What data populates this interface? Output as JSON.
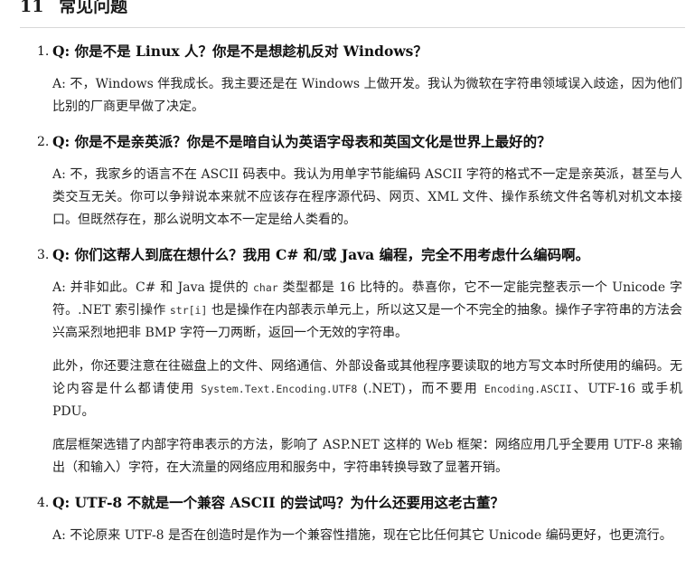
{
  "section": {
    "number": "11",
    "title": "常见问题"
  },
  "faq": [
    {
      "num": "1.",
      "question": "Q: 你是不是 Linux 人？你是不是想趁机反对 Windows？",
      "answers": [
        [
          {
            "t": "A: 不，Windows 伴我成长。我主要还是在 Windows 上做开发。我认为微软在字符串领域误入歧途，因为他们比别的厂商更早做了决定。"
          }
        ]
      ]
    },
    {
      "num": "2.",
      "question": "Q: 你是不是亲英派？你是不是暗自认为英语字母表和英国文化是世界上最好的？",
      "answers": [
        [
          {
            "t": "A: 不，我家乡的语言不在 ASCII 码表中。我认为用单字节能编码 ASCII 字符的格式不一定是亲英派，甚至与人类交互无关。你可以争辩说本来就不应该存在程序源代码、网页、XML 文件、操作系统文件名等机对机文本接口。但既然存在，那么说明文本不一定是给人类看的。"
          }
        ]
      ]
    },
    {
      "num": "3.",
      "question": "Q: 你们这帮人到底在想什么？我用 C# 和/或 Java 编程，完全不用考虑什么编码啊。",
      "answers": [
        [
          {
            "t": "A: 并非如此。C# 和 Java 提供的 "
          },
          {
            "t": "char",
            "code": true
          },
          {
            "t": " 类型都是 16 比特的。恭喜你，它不一定能完整表示一个 Unicode 字符。.NET 索引操作 "
          },
          {
            "t": "str[i]",
            "code": true
          },
          {
            "t": " 也是操作在内部表示单元上，所以这又是一个不完全的抽象。操作子字符串的方法会兴高采烈地把非 BMP 字符一刀两断，返回一个无效的字符串。"
          }
        ],
        [
          {
            "t": "此外，你还要注意在往磁盘上的文件、网络通信、外部设备或其他程序要读取的地方写文本时所使用的编码。无论内容是什么都请使用 "
          },
          {
            "t": "System.Text.Encoding.UTF8",
            "code": true
          },
          {
            "t": " (.NET)，而不要用 "
          },
          {
            "t": "Encoding.ASCII",
            "code": true
          },
          {
            "t": "、UTF-16 或手机 PDU。"
          }
        ],
        [
          {
            "t": "底层框架选错了内部字符串表示的方法，影响了 ASP.NET 这样的 Web 框架：网络应用几乎全要用 UTF-8 来输出（和输入）字符，在大流量的网络应用和服务中，字符串转换导致了显著开销。"
          }
        ]
      ]
    },
    {
      "num": "4.",
      "question": "Q: UTF-8 不就是一个兼容 ASCII 的尝试吗？为什么还要用这老古董？",
      "answers": [
        [
          {
            "t": "A: 不论原来 UTF-8 是否在创造时是作为一个兼容性措施，现在它比任何其它 Unicode 编码更好，也更流行。"
          }
        ]
      ]
    }
  ]
}
